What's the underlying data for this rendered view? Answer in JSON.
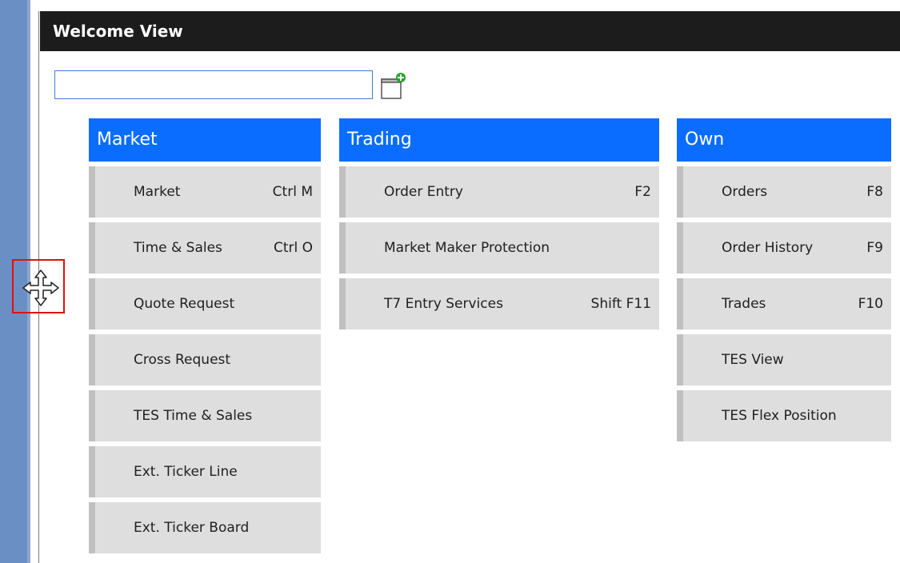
{
  "window": {
    "title": "Welcome View"
  },
  "search": {
    "value": "",
    "placeholder": ""
  },
  "icons": {
    "add_widget": "add-widget-icon",
    "move_cursor": "move-cursor-icon"
  },
  "colors": {
    "header_blue": "#0a6dff",
    "titlebar": "#1c1c1c",
    "item_bg": "#dedede",
    "highlight_red": "#e01010"
  },
  "groups": [
    {
      "title": "Market",
      "items": [
        {
          "label": "Market",
          "shortcut": "Ctrl M"
        },
        {
          "label": "Time & Sales",
          "shortcut": "Ctrl O"
        },
        {
          "label": "Quote Request",
          "shortcut": ""
        },
        {
          "label": "Cross Request",
          "shortcut": ""
        },
        {
          "label": "TES Time & Sales",
          "shortcut": ""
        },
        {
          "label": "Ext. Ticker Line",
          "shortcut": ""
        },
        {
          "label": "Ext. Ticker Board",
          "shortcut": ""
        }
      ]
    },
    {
      "title": "Trading",
      "items": [
        {
          "label": "Order Entry",
          "shortcut": "F2"
        },
        {
          "label": "Market Maker Protection",
          "shortcut": ""
        },
        {
          "label": "T7 Entry Services",
          "shortcut": "Shift F11"
        }
      ]
    },
    {
      "title": "Own",
      "items": [
        {
          "label": "Orders",
          "shortcut": "F8"
        },
        {
          "label": "Order History",
          "shortcut": "F9"
        },
        {
          "label": "Trades",
          "shortcut": "F10"
        },
        {
          "label": "TES View",
          "shortcut": ""
        },
        {
          "label": "TES Flex Position",
          "shortcut": ""
        }
      ]
    }
  ]
}
